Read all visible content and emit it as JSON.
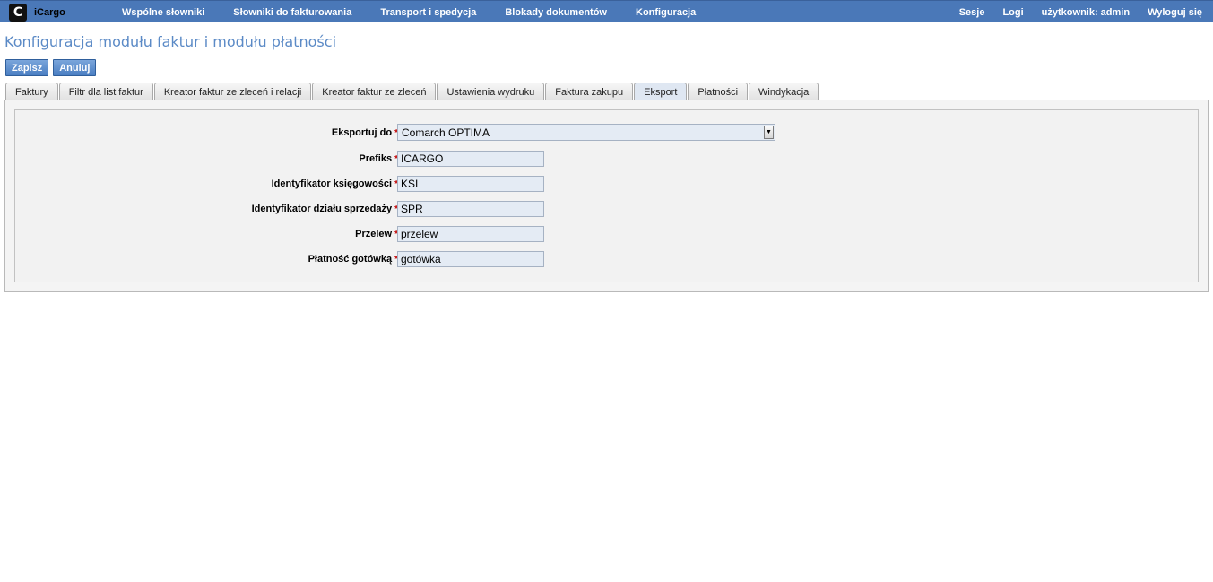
{
  "app": {
    "name": "iCargo",
    "logo_glyph": "C"
  },
  "nav": {
    "left": [
      "Wspólne słowniki",
      "Słowniki do fakturowania",
      "Transport i spedycja",
      "Blokady dokumentów",
      "Konfiguracja"
    ],
    "sessions": "Sesje",
    "logs": "Logi",
    "user": "użytkownik: admin",
    "logout": "Wyloguj się"
  },
  "page": {
    "title": "Konfiguracja modułu faktur i modułu płatności"
  },
  "actions": {
    "save": "Zapisz",
    "cancel": "Anuluj"
  },
  "tabs": {
    "items": [
      "Faktury",
      "Filtr dla list faktur",
      "Kreator faktur ze zleceń i relacji",
      "Kreator faktur ze zleceń",
      "Ustawienia wydruku",
      "Faktura zakupu",
      "Eksport",
      "Płatności",
      "Windykacja"
    ],
    "active": "Eksport"
  },
  "form": {
    "required_mark": "*",
    "export_to": {
      "label": "Eksportuj do",
      "value": "Comarch OPTIMA"
    },
    "prefix": {
      "label": "Prefiks",
      "value": "ICARGO"
    },
    "accounting_id": {
      "label": "Identyfikator księgowości",
      "value": "KSI"
    },
    "sales_id": {
      "label": "Identyfikator działu sprzedaży",
      "value": "SPR"
    },
    "transfer": {
      "label": "Przelew",
      "value": "przelew"
    },
    "cash": {
      "label": "Płatność gotówką",
      "value": "gotówka"
    }
  },
  "colors": {
    "nav_bg": "#4a78b8",
    "title": "#5b8ac6",
    "required": "#c00000"
  }
}
